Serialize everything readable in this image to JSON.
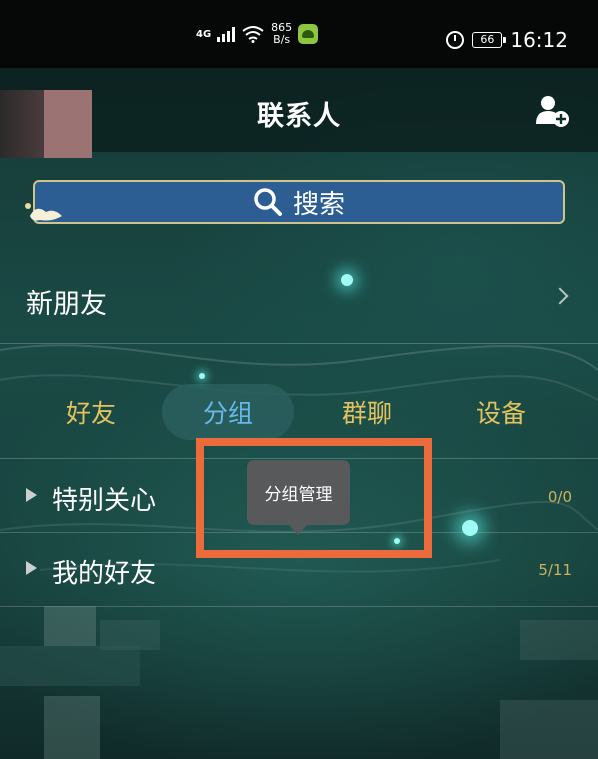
{
  "status_bar": {
    "network": "4G",
    "speed_value": "865",
    "speed_unit": "B/s",
    "battery": "66",
    "time": "16:12"
  },
  "header": {
    "title": "联系人"
  },
  "search": {
    "label": "搜索"
  },
  "new_friends": {
    "label": "新朋友"
  },
  "tabs": [
    {
      "label": "好友"
    },
    {
      "label": "分组"
    },
    {
      "label": "群聊"
    },
    {
      "label": "设备"
    }
  ],
  "groups": [
    {
      "label": "特别关心",
      "count": "0/0"
    },
    {
      "label": "我的好友",
      "count": "5/11"
    }
  ],
  "tooltip": {
    "label": "分组管理"
  },
  "colors": {
    "accent_gold": "#e2c35f",
    "active_tab": "#67b8ea",
    "search_bg": "#2d5e93",
    "highlight": "#ec6b3c"
  }
}
